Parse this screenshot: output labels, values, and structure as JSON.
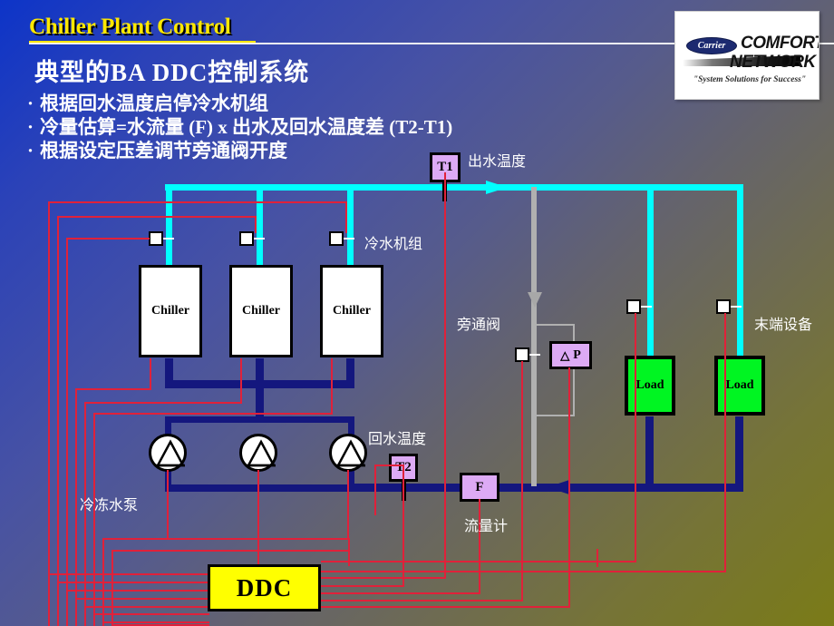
{
  "header": {
    "title": "Chiller Plant Control"
  },
  "logo": {
    "brand": "Carrier",
    "line1": "COMFORT",
    "line2": "NETWORK",
    "tagline": "\"System Solutions for Success\""
  },
  "content": {
    "headline": "典型的BA DDC控制系统",
    "bullets": [
      "根据回水温度启停冷水机组",
      "冷量估算=水流量 (F) x 出水及回水温度差 (T2-T1)",
      "根据设定压差调节旁通阀开度"
    ],
    "bullet_marker": "·"
  },
  "diagram": {
    "chillers": [
      {
        "label": "Chiller"
      },
      {
        "label": "Chiller"
      },
      {
        "label": "Chiller"
      }
    ],
    "loads": [
      {
        "label": "Load"
      },
      {
        "label": "Load"
      }
    ],
    "sensors": {
      "t1": "T1",
      "t2": "T2",
      "flow": "F",
      "dp": "P",
      "dp_symbol": "△"
    },
    "controller": "DDC",
    "labels": {
      "supply_temp": "出水温度",
      "chiller_group": "冷水机组",
      "bypass_valve": "旁通阀",
      "terminal_units": "末端设备",
      "return_temp": "回水温度",
      "chilled_water_pump": "冷冻水泵",
      "flow_meter": "流量计"
    }
  },
  "colors": {
    "supply_pipe": "#00ffff",
    "return_pipe": "#14177e",
    "control_wire": "#e0213a",
    "bypass": "#b0b0b0",
    "sensor_fill": "#ddaaf5",
    "load_fill": "#00f522",
    "controller_fill": "#ffff00",
    "title_text": "#ffe800"
  }
}
